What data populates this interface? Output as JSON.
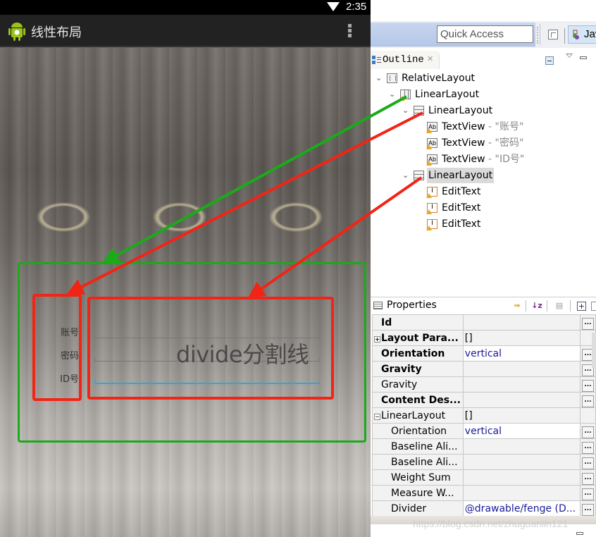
{
  "phone": {
    "status_bar": {
      "time": "2:35",
      "wifi_icon": "wifi-icon"
    },
    "action_bar": {
      "title": "线性布局",
      "app_icon": "android-icon",
      "overflow_icon": "overflow-menu-icon"
    },
    "labels": [
      "账号",
      "密码",
      "ID号"
    ],
    "divider_text": "divide分割线",
    "annotations": {
      "outer_color": "#1aaa1a",
      "inner_color": "#f22416"
    }
  },
  "ide": {
    "toolbar": {
      "quick_access_placeholder": "Quick Access",
      "perspective_label": "Jav"
    },
    "outline": {
      "tab_label": "Outline",
      "close_glyph": "✕",
      "tree": [
        {
          "label": "RelativeLayout",
          "suffix": "",
          "icon": "relative-layout-icon"
        },
        {
          "label": "LinearLayout",
          "suffix": "",
          "icon": "linear-layout-horizontal-icon"
        },
        {
          "label": "LinearLayout",
          "suffix": "",
          "icon": "linear-layout-vertical-icon"
        },
        {
          "label": "TextView",
          "suffix": " - \"账号\"",
          "icon": "textview-icon"
        },
        {
          "label": "TextView",
          "suffix": " - \"密码\"",
          "icon": "textview-icon"
        },
        {
          "label": "TextView",
          "suffix": " - \"ID号\"",
          "icon": "textview-icon"
        },
        {
          "label": "LinearLayout",
          "suffix": "",
          "icon": "linear-layout-vertical-icon",
          "selected": true
        },
        {
          "label": "EditText",
          "suffix": "",
          "icon": "edittext-icon"
        },
        {
          "label": "EditText",
          "suffix": "",
          "icon": "edittext-icon"
        },
        {
          "label": "EditText",
          "suffix": "",
          "icon": "edittext-icon"
        }
      ]
    },
    "properties": {
      "title": "Properties",
      "rows": [
        {
          "name": "Id",
          "value": "",
          "style": "bold"
        },
        {
          "name": "Layout Para...",
          "value": "[]",
          "style": "bold",
          "expander": "+"
        },
        {
          "name": "Orientation",
          "value": "vertical",
          "style": "bold"
        },
        {
          "name": "Gravity",
          "value": "",
          "style": "bold"
        },
        {
          "name": "Gravity",
          "value": "",
          "style": "normal"
        },
        {
          "name": "Content Des...",
          "value": "",
          "style": "bold"
        },
        {
          "name": "LinearLayout",
          "value": "[]",
          "style": "group",
          "expander": "−"
        },
        {
          "name": "Orientation",
          "value": "vertical",
          "style": "sub"
        },
        {
          "name": "Baseline Ali...",
          "value": "",
          "style": "sub"
        },
        {
          "name": "Baseline Ali...",
          "value": "",
          "style": "sub"
        },
        {
          "name": "Weight Sum",
          "value": "",
          "style": "sub"
        },
        {
          "name": "Measure W...",
          "value": "",
          "style": "sub"
        },
        {
          "name": "Divider",
          "value": "@drawable/fenge (D...",
          "style": "sub"
        }
      ],
      "ellipsis_label": "..."
    },
    "watermark": "https://blog.csdn.net/zhuguanlin121"
  }
}
